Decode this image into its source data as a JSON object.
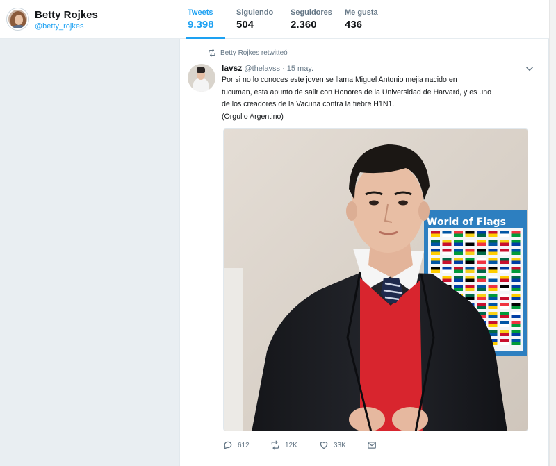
{
  "profile": {
    "name": "Betty Rojkes",
    "handle": "@betty_rojkes"
  },
  "stats": [
    {
      "label": "Tweets",
      "value": "9.398"
    },
    {
      "label": "Siguiendo",
      "value": "504"
    },
    {
      "label": "Seguidores",
      "value": "2.360"
    },
    {
      "label": "Me gusta",
      "value": "436"
    }
  ],
  "tweet": {
    "retweeted_by": "Betty Rojkes retwitteó",
    "author_name": "lavsz",
    "author_handle": "@thelavss",
    "date": "· 15 may.",
    "text_line_1": "Por si no lo conoces este joven se llama Miguel Antonio mejia nacido en",
    "text_line_2": "tucuman, esta apunto de salir con Honores de la Universidad de Harvard, y es uno",
    "text_line_3": "de los creadores de la Vacuna contra la fiebre H1N1.",
    "text_line_4": "(Orgullo Argentino)",
    "media_poster_title": "World of Flags",
    "replies": "612",
    "retweets": "12K",
    "likes": "33K"
  },
  "icons": {
    "retweet": "retweet-icon",
    "reply": "reply-icon",
    "like": "heart-icon",
    "dm": "envelope-icon",
    "caret": "chevron-down-icon"
  },
  "colors": {
    "accent": "#1da1f2",
    "muted": "#657786",
    "page_bg": "#e6ecf0"
  }
}
